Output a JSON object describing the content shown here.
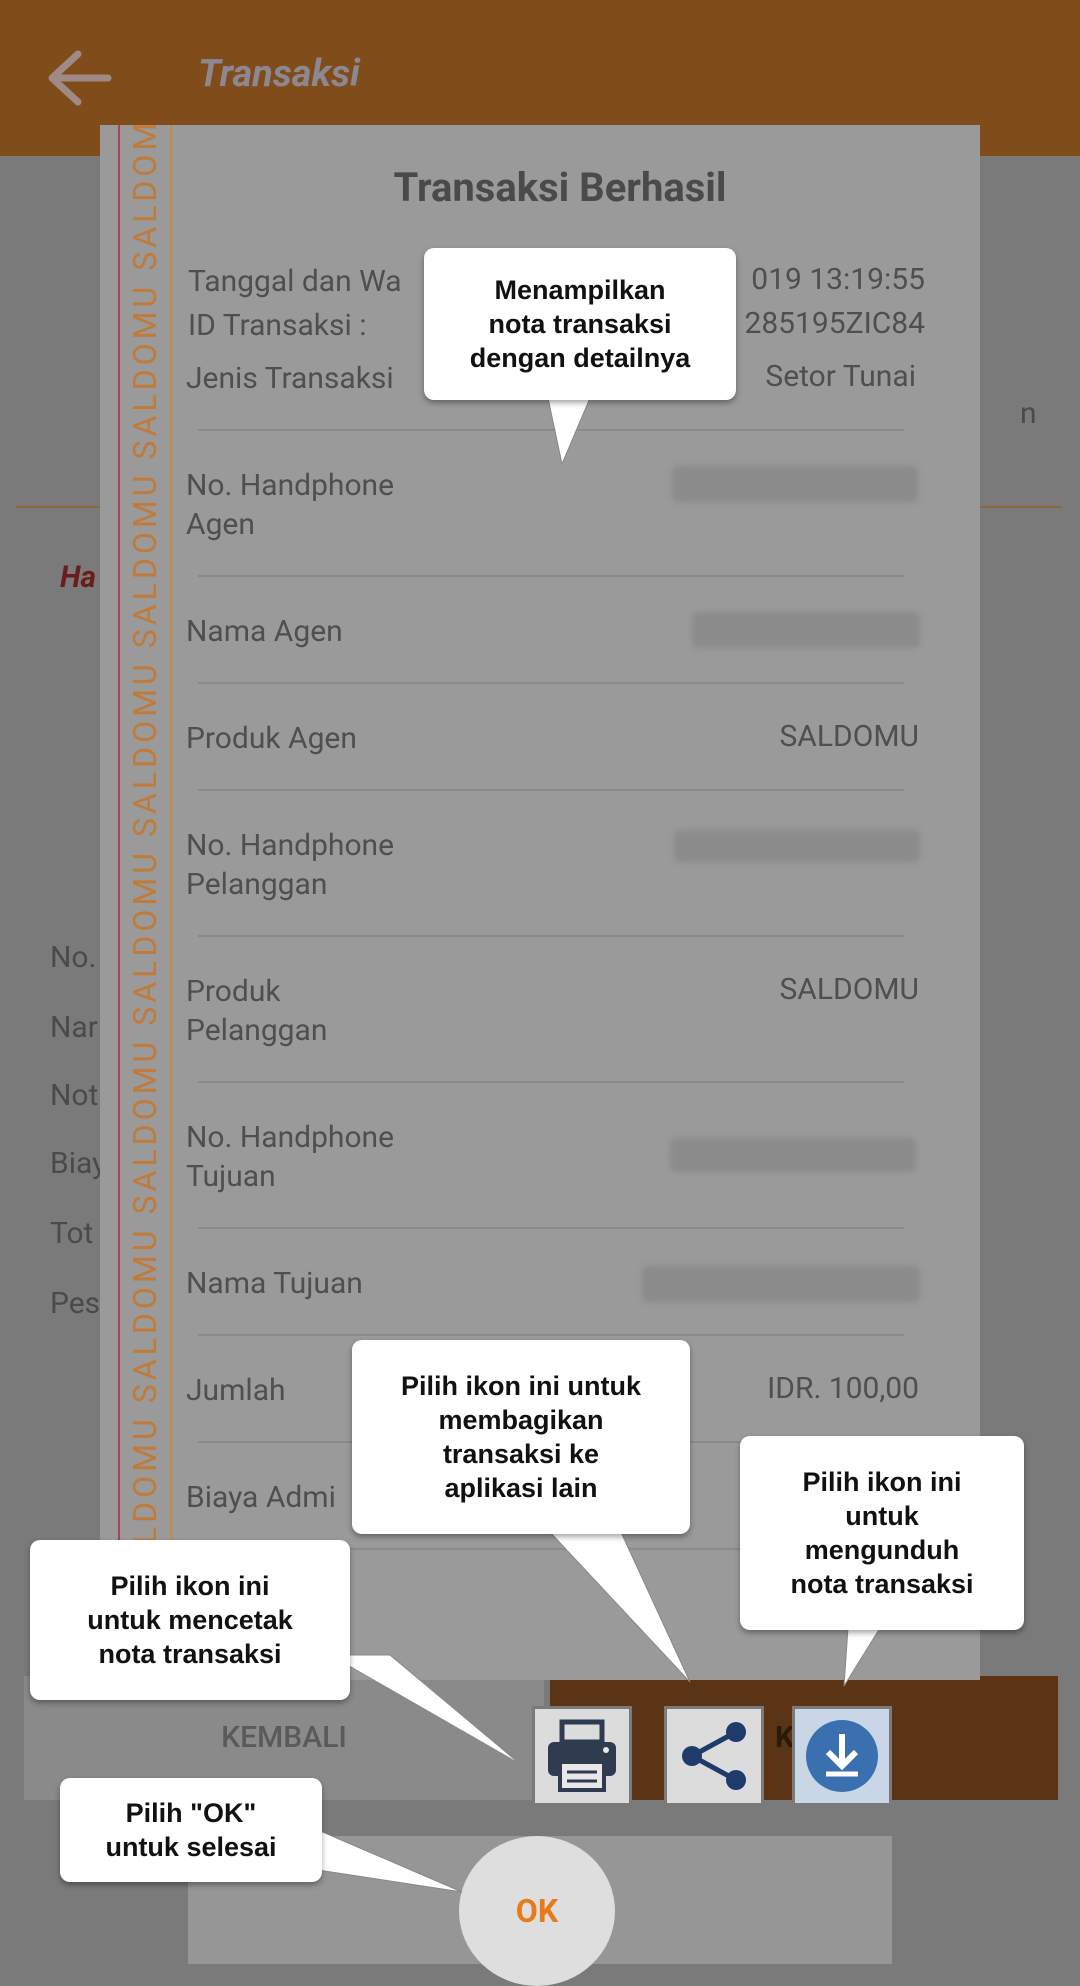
{
  "app_bar": {
    "title": "Transaksi",
    "back_icon": "arrow-left-icon"
  },
  "background": {
    "partial_right_text": "n",
    "note_text": "Ha",
    "rows": [
      "No.",
      "Nar",
      "Not",
      "Biay",
      "Tot",
      "Pes"
    ]
  },
  "receipt": {
    "watermark": "SALDOMU SALDOMU SALDOMU SALDOMU SALDOMU SALDOMU SALDOMU SALDOMU SALDOMU SALDOMU",
    "title": "Transaksi Berhasil",
    "date_label": "Tanggal dan Wa",
    "date_value": "019 13:19:55",
    "id_label": "ID Transaksi :",
    "id_value": "285195ZIC84",
    "rows": [
      {
        "label": "Jenis Transaksi",
        "value": "Setor Tunai"
      },
      {
        "label": "No. Handphone\nAgen",
        "value": ""
      },
      {
        "label": "Nama Agen",
        "value": ""
      },
      {
        "label": "Produk Agen",
        "value": "SALDOMU"
      },
      {
        "label": "No. Handphone\nPelanggan",
        "value": ""
      },
      {
        "label": "Produk\nPelanggan",
        "value": "SALDOMU"
      },
      {
        "label": "No. Handphone\nTujuan",
        "value": ""
      },
      {
        "label": "Nama Tujuan",
        "value": ""
      },
      {
        "label": "Jumlah",
        "value": "IDR. 100,00"
      },
      {
        "label": "Biaya Admi",
        "value": ""
      }
    ]
  },
  "actions": {
    "kembali_label": "KEMBALI",
    "cetak_partial_label": "KI",
    "ok_label": "OK",
    "print_icon": "printer-icon",
    "share_icon": "share-icon",
    "download_icon": "download-icon"
  },
  "callouts": {
    "receipt": "Menampilkan\nnota transaksi\ndengan detailnya",
    "share": "Pilih ikon ini untuk\nmembagikan\ntransaksi ke\naplikasi lain",
    "download": "Pilih ikon ini\nuntuk\nmengunduh\nnota transaksi",
    "print": "Pilih ikon ini\nuntuk mencetak\nnota transaksi",
    "ok": "Pilih \"OK\"\nuntuk selesai"
  },
  "colors": {
    "app_bar": "#7f4c1a",
    "accent_orange": "#e87a1a",
    "download_blue": "#3a6fb0",
    "icon_dark": "#2f3b4f"
  }
}
